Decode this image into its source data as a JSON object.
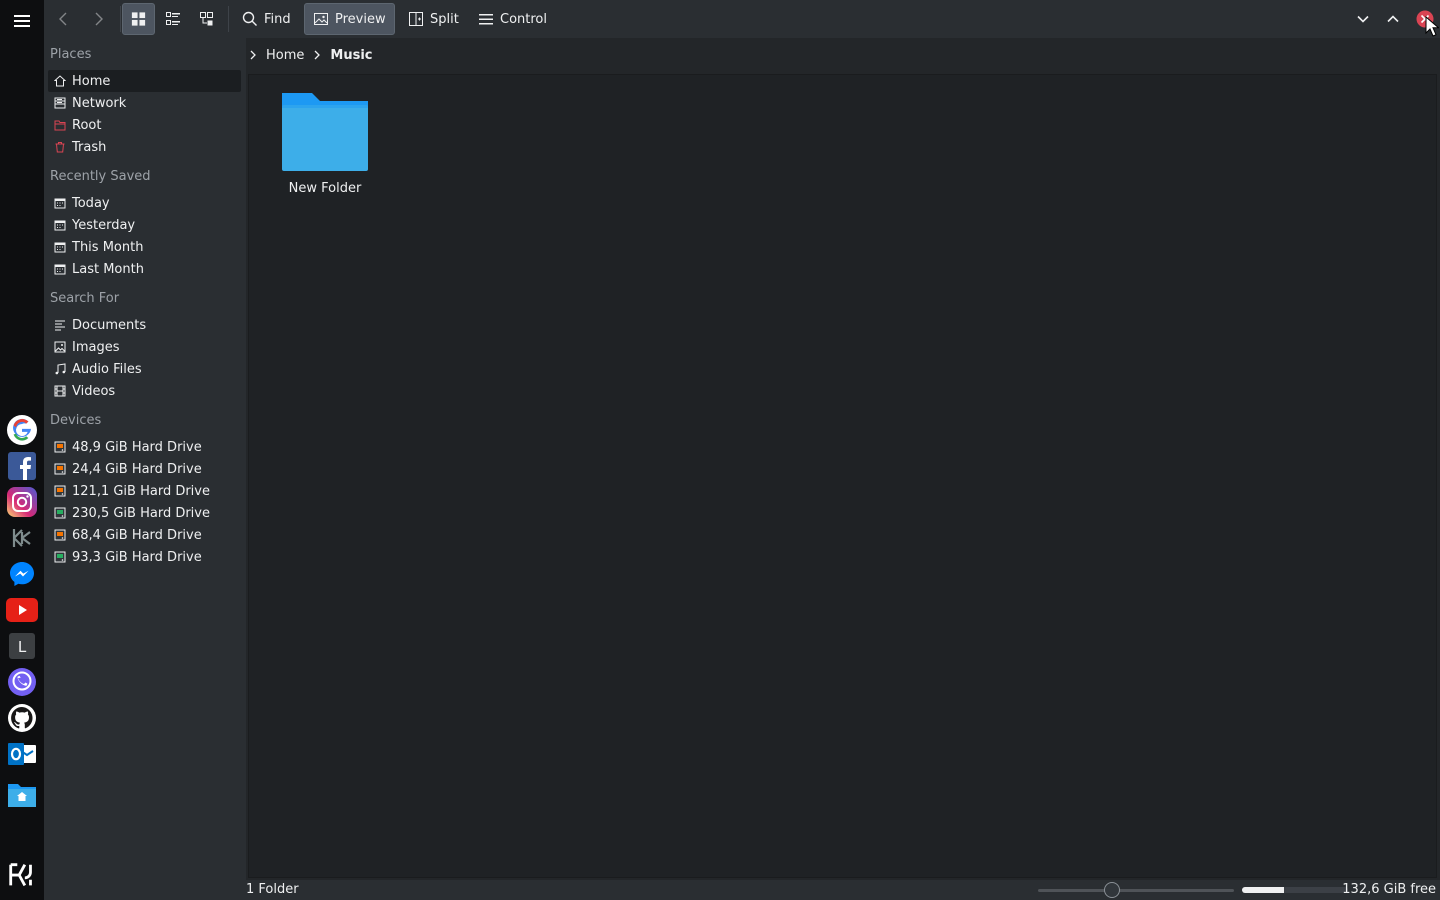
{
  "toolbar": {
    "find_label": "Find",
    "preview_label": "Preview",
    "split_label": "Split",
    "control_label": "Control"
  },
  "sidebar": {
    "places_title": "Places",
    "places": [
      {
        "label": "Home",
        "icon": "home-icon"
      },
      {
        "label": "Network",
        "icon": "network-icon"
      },
      {
        "label": "Root",
        "icon": "root-folder-icon"
      },
      {
        "label": "Trash",
        "icon": "trash-icon"
      }
    ],
    "recent_title": "Recently Saved",
    "recent": [
      {
        "label": "Today"
      },
      {
        "label": "Yesterday"
      },
      {
        "label": "This Month"
      },
      {
        "label": "Last Month"
      }
    ],
    "search_title": "Search For",
    "search": [
      {
        "label": "Documents",
        "icon": "documents-icon"
      },
      {
        "label": "Images",
        "icon": "images-icon"
      },
      {
        "label": "Audio Files",
        "icon": "audio-icon"
      },
      {
        "label": "Videos",
        "icon": "video-icon"
      }
    ],
    "devices_title": "Devices",
    "devices": [
      {
        "label": "48,9 GiB Hard Drive"
      },
      {
        "label": "24,4 GiB Hard Drive"
      },
      {
        "label": "121,1 GiB Hard Drive"
      },
      {
        "label": "230,5 GiB Hard Drive"
      },
      {
        "label": "68,4 GiB Hard Drive"
      },
      {
        "label": "93,3 GiB Hard Drive"
      }
    ]
  },
  "breadcrumb": {
    "items": [
      "Home",
      "Music"
    ]
  },
  "main": {
    "items": [
      {
        "label": "New Folder",
        "icon": "folder-icon"
      }
    ]
  },
  "statusbar": {
    "summary": "1 Folder",
    "zoom_level": 0.38,
    "space_used_fraction": 0.4,
    "free_text": "132,6 GiB free"
  },
  "dock": {
    "apps": [
      "google-icon",
      "facebook-icon",
      "instagram-icon",
      "kde-icon",
      "messenger-icon",
      "youtube-icon",
      "l-app-icon",
      "viber-icon",
      "github-icon",
      "outlook-icon",
      "home-folder-icon"
    ],
    "bottom_letter": "L"
  },
  "colors": {
    "accent": "#3daee9",
    "window_bg": "#232629",
    "close_red": "#da4453"
  }
}
